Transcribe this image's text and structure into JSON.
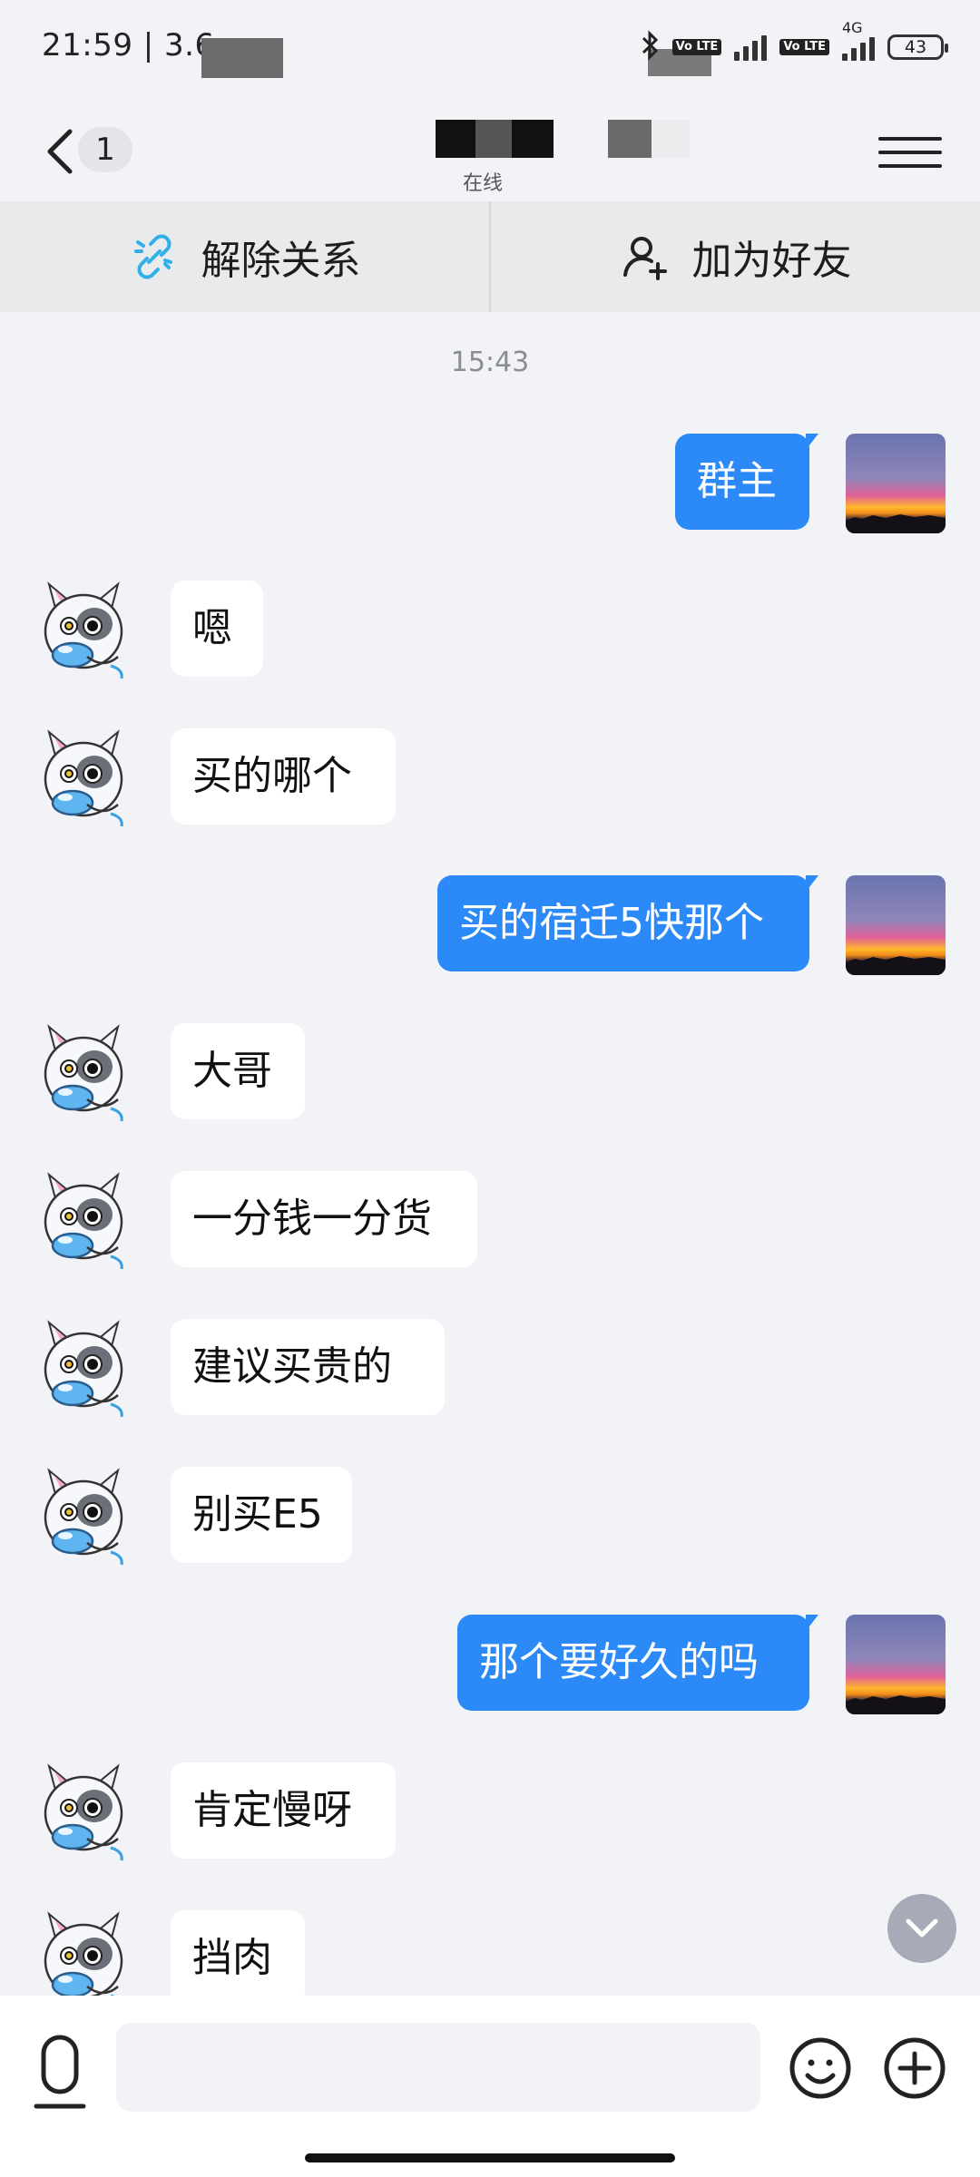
{
  "status_bar": {
    "time": "21:59 | 3.6",
    "battery": "43",
    "network": "4G",
    "volte_label": "Vo LTE"
  },
  "header": {
    "back_count": "1",
    "subtitle": "在线"
  },
  "actions": {
    "unlink_label": "解除关系",
    "add_friend_label": "加为好友"
  },
  "chat": {
    "timestamp": "15:43",
    "messages": [
      {
        "side": "out",
        "text": "群主"
      },
      {
        "side": "in",
        "text": "嗯"
      },
      {
        "side": "in",
        "text": "买的哪个"
      },
      {
        "side": "out",
        "text": "买的宿迁5快那个"
      },
      {
        "side": "in",
        "text": "大哥"
      },
      {
        "side": "in",
        "text": "一分钱一分货"
      },
      {
        "side": "in",
        "text": "建议买贵的"
      },
      {
        "side": "in",
        "text": "别买E5"
      },
      {
        "side": "out",
        "text": "那个要好久的吗"
      },
      {
        "side": "in",
        "text": "肯定慢呀"
      },
      {
        "side": "in",
        "text": "挡肉"
      }
    ]
  },
  "input": {
    "placeholder": ""
  },
  "colors": {
    "accent": "#2c8af8",
    "background": "#f2f3f7",
    "incoming_bubble": "#ffffff"
  },
  "icons": {
    "back": "chevron-left-icon",
    "menu": "hamburger-menu-icon",
    "unlink": "broken-link-icon",
    "add_friend": "add-user-icon",
    "mic": "microphone-icon",
    "emoji": "smiley-icon",
    "plus": "plus-circle-icon",
    "scroll_down": "chevron-down-icon"
  }
}
